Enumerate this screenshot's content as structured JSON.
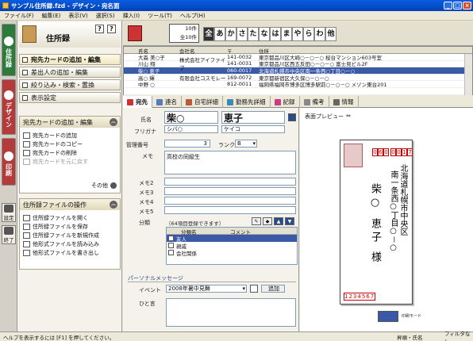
{
  "window": {
    "title": "サンプル住所録.fzd - デザイン・宛名面",
    "buttons": [
      "_",
      "□",
      "×"
    ]
  },
  "menu": [
    "ファイル(F)",
    "編集(E)",
    "表示(V)",
    "選択(S)",
    "挿入(I)",
    "ツール(T)",
    "ヘルプ(H)"
  ],
  "left_tabs": {
    "juusho": "住所録",
    "design": "デザイン",
    "print": "印刷",
    "settings": "設定",
    "exit": "終了"
  },
  "left_pane": {
    "title": "住所録",
    "help_icons": [
      "?",
      "?"
    ],
    "nav": [
      "宛先カードの追加・編集",
      "差出人の追加・編集",
      "絞り込み・検索・置換",
      "表示設定"
    ],
    "panel1": {
      "title": "宛先カードの追加・編集",
      "items": [
        "宛先カードの追加",
        "宛先カードのコピー",
        "宛先カードの削除",
        "宛先カードを元に戻す"
      ],
      "more": "その他"
    },
    "panel2": {
      "title": "住所録ファイルの操作",
      "items": [
        "住所録ファイルを開く",
        "住所録ファイルを保存",
        "住所録ファイルを新規作成",
        "他形式ファイルを読み込み",
        "他形式ファイルを書き出し"
      ]
    }
  },
  "toolbar": {
    "count_selected": "10件",
    "count_total": "全10件",
    "kana": [
      "全",
      "あ",
      "か",
      "さ",
      "た",
      "な",
      "は",
      "ま",
      "や",
      "ら",
      "わ",
      "他"
    ]
  },
  "list": {
    "headers": [
      "",
      "氏名",
      "会社名",
      "〒",
      "住所"
    ],
    "rows": [
      [
        "",
        "大森 美○子",
        "",
        "141-0032",
        "東京都品川区大崎○－○－○ 桜台マンション603号室"
      ],
      [
        "",
        "川山 翔",
        "株式会社アイファイブ",
        "141-0031",
        "東京都品川区西五反田○－○－○ 富士見ビル2F"
      ],
      [
        "",
        "柴○ 恵子",
        "",
        "060-0017",
        "北海道札幌市中央区南一条西○丁目○－○"
      ],
      [
        "",
        "高○ 輝",
        "有限会社コスモレー",
        "169-0072",
        "東京都新宿区大久保○－○－○"
      ],
      [
        "",
        "中野 ○",
        "",
        "812-0011",
        "福岡県福岡市博多区博多駅前○－○－○ メゾン東台201"
      ],
      [
        "",
        "",
        "",
        "",
        ""
      ]
    ]
  },
  "tabs": [
    "宛先",
    "連名",
    "自宅詳細",
    "勤務先詳細",
    "記録",
    "備考",
    "情報"
  ],
  "form": {
    "name_label": "氏名",
    "last": "柴○",
    "first": "恵子",
    "furigana_label": "フリガナ",
    "furi_last": "シバ○",
    "furi_first": "ケイコ",
    "mgmt_label": "管理番号",
    "mgmt_value": "3",
    "rank_label": "ランク",
    "rank_value": "B",
    "memo_label": "メモ",
    "memo_value": "高校の同級生",
    "memo2": "メモ2",
    "memo3": "メモ3",
    "memo4": "メモ4",
    "memo5": "メモ5",
    "cat_label": "分類",
    "cat_hint": "（64項目登録できます）",
    "cat_headers": [
      "分類名",
      "コメント"
    ],
    "categories": [
      {
        "name": "友人",
        "checked": "✓"
      },
      {
        "name": "親戚",
        "checked": ""
      },
      {
        "name": "会社関係",
        "checked": ""
      }
    ],
    "personal_title": "パーソナルメッセージ",
    "event_label": "イベント",
    "event_value": "2008年暑中見舞",
    "add_btn": "追加",
    "hitokoto_label": "ひと言"
  },
  "preview": {
    "title": "表面プレビュー",
    "zip": [
      "0",
      "6",
      "0",
      "0",
      "0",
      "1",
      "7"
    ],
    "address_col1": "北海道札幌市中央区",
    "address_col2": "南一条西○丁目○－○",
    "name": "柴○ 恵子 様",
    "sender_zip": "1234567",
    "sender_label": "印刷モード"
  },
  "status": {
    "left": "ヘルプを表示するには [F1] を押してください。",
    "mid": "昇順・氏名",
    "right": "フィルタなし"
  },
  "colors": {
    "title_bar": "#0a5ce0",
    "selection": "#3a5aa8",
    "tab_green": "#2d7a3a",
    "tab_red": "#b53a3a",
    "zip_red": "#cc0000"
  }
}
